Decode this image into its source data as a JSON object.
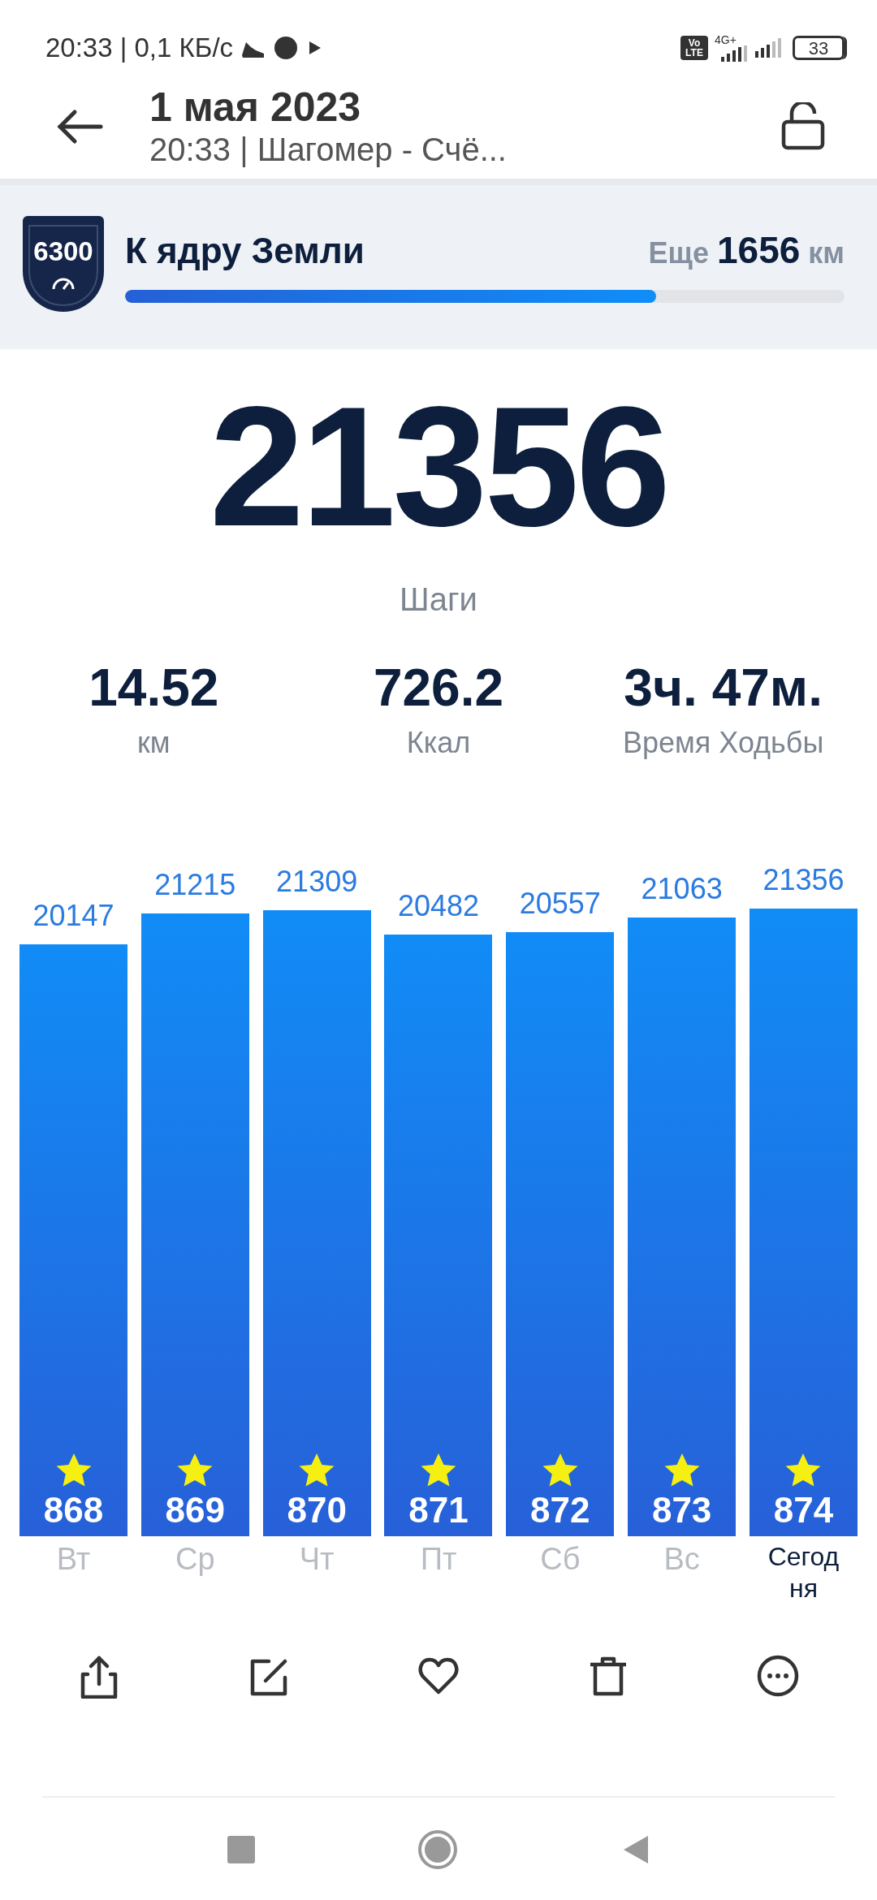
{
  "status_bar": {
    "time_speed": "20:33 | 0,1 КБ/с",
    "volte": [
      "Vo",
      "LTE"
    ],
    "network": "4G+",
    "battery": "33"
  },
  "header": {
    "title": "1 мая 2023",
    "subtitle": "20:33 | Шагомер - Счё..."
  },
  "goal": {
    "badge": "6300",
    "title": "К ядру Земли",
    "remaining_prefix": "Еще",
    "remaining_value": "1656",
    "remaining_unit": "км",
    "level": 0.738
  },
  "steps": {
    "value": "21356",
    "label": "Шаги"
  },
  "stats": [
    {
      "value": "14.52",
      "label": "км"
    },
    {
      "value": "726.2",
      "label": "Ккал"
    },
    {
      "value": "3ч. 47м.",
      "label": "Время Ходьбы"
    }
  ],
  "chart_data": {
    "type": "bar",
    "categories": [
      "Вт",
      "Ср",
      "Чт",
      "Пт",
      "Сб",
      "Вс",
      "Сегодня"
    ],
    "values": [
      20147,
      21215,
      21309,
      20482,
      20557,
      21063,
      21356
    ],
    "data_labels": true
  },
  "days": [
    {
      "count": "868",
      "selected": false
    },
    {
      "count": "869",
      "selected": false
    },
    {
      "count": "870",
      "selected": false
    },
    {
      "count": "871",
      "selected": false
    },
    {
      "count": "872",
      "selected": false
    },
    {
      "count": "873",
      "selected": false
    },
    {
      "count": "874",
      "selected": true
    }
  ]
}
